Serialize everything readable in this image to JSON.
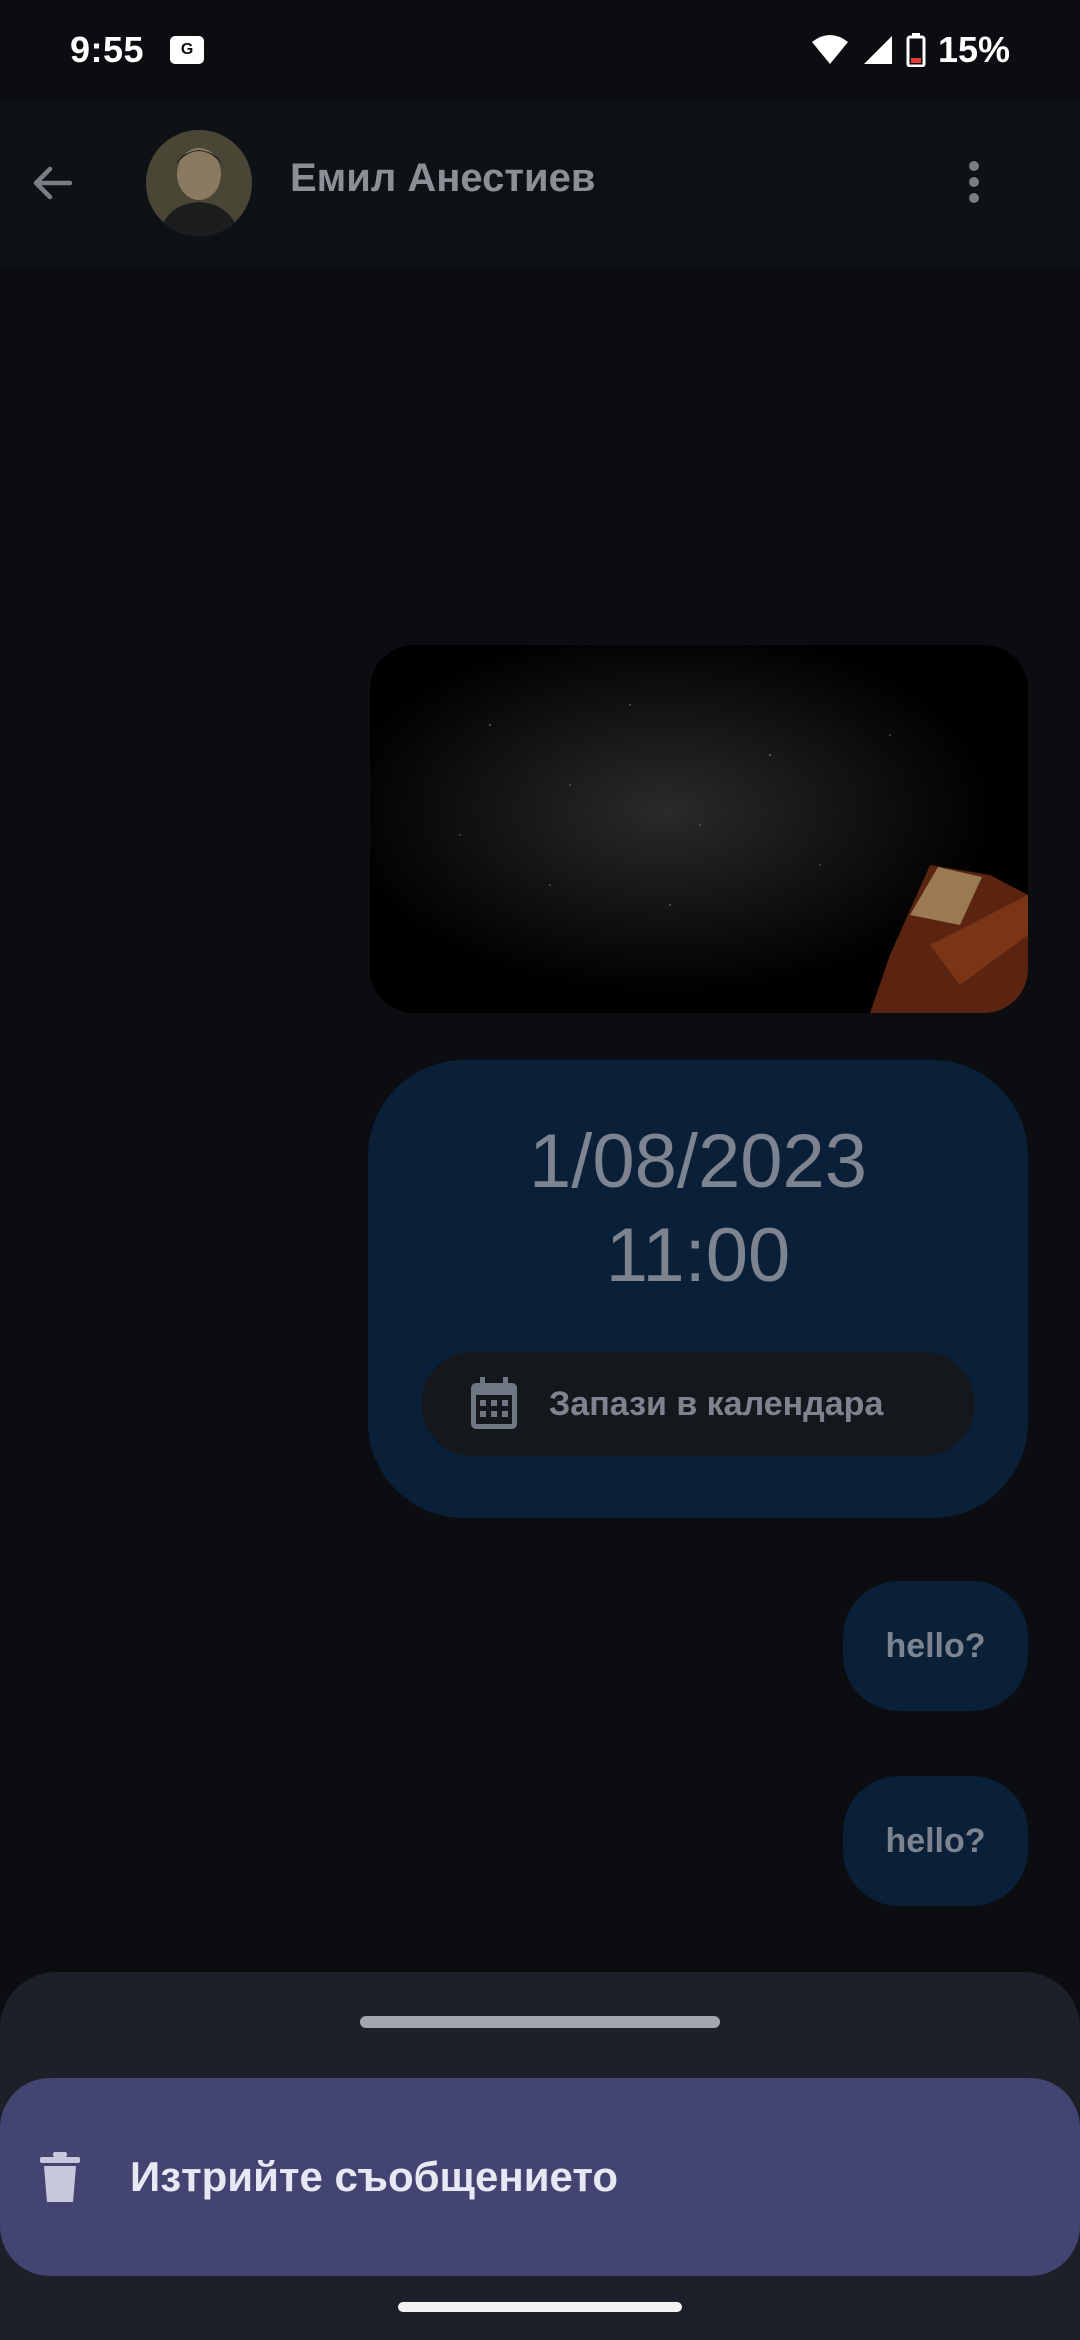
{
  "status_bar": {
    "time": "9:55",
    "notification_badge": "G",
    "battery": "15%",
    "icons": [
      "wifi-icon",
      "signal-icon",
      "battery-icon"
    ]
  },
  "header": {
    "back_icon": "arrow-left-icon",
    "contact_name": "Емил Анестиев",
    "more_icon": "more-vert-icon"
  },
  "messages": {
    "image_description_icon": "photo-night-sky",
    "date_card": {
      "date": "1/08/2023",
      "time": "11:00",
      "calendar_button_label": "Запази в календара",
      "calendar_icon": "calendar-icon"
    },
    "texts": [
      "hello?",
      "hello?"
    ]
  },
  "bottom_sheet": {
    "delete_label": "Изтрийте съобщението",
    "delete_icon": "trash-icon"
  },
  "colors": {
    "background": "#0b0d11",
    "bubble": "#0a2038",
    "sheet": "#1c2029",
    "action": "#444472"
  }
}
